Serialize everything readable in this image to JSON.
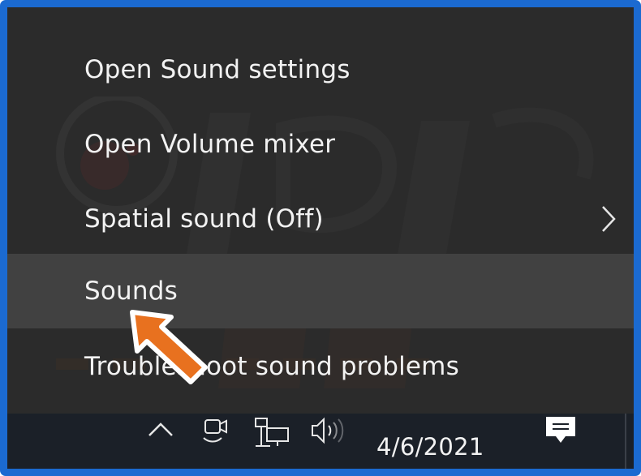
{
  "menu": {
    "items": [
      {
        "label": "Open Sound settings",
        "has_submenu": false,
        "highlighted": false
      },
      {
        "label": "Open Volume mixer",
        "has_submenu": false,
        "highlighted": false
      },
      {
        "label": "Spatial sound (Off)",
        "has_submenu": true,
        "highlighted": false
      },
      {
        "label": "Sounds",
        "has_submenu": false,
        "highlighted": true
      },
      {
        "label": "Troubleshoot sound problems",
        "has_submenu": false,
        "highlighted": false
      }
    ],
    "submenu_icon": "chevron-right-icon"
  },
  "taskbar": {
    "date": "4/6/2021",
    "icons": [
      "chevron-up-icon",
      "camera-icon",
      "network-icon",
      "speaker-icon",
      "notification-icon"
    ]
  },
  "colors": {
    "frame_border": "#1b6ad1",
    "menu_bg": "#2b2b2b",
    "highlight_bg": "#414141",
    "taskbar_bg": "#1b2028",
    "text": "#f2f2f2",
    "pointer": "#e8711f"
  }
}
